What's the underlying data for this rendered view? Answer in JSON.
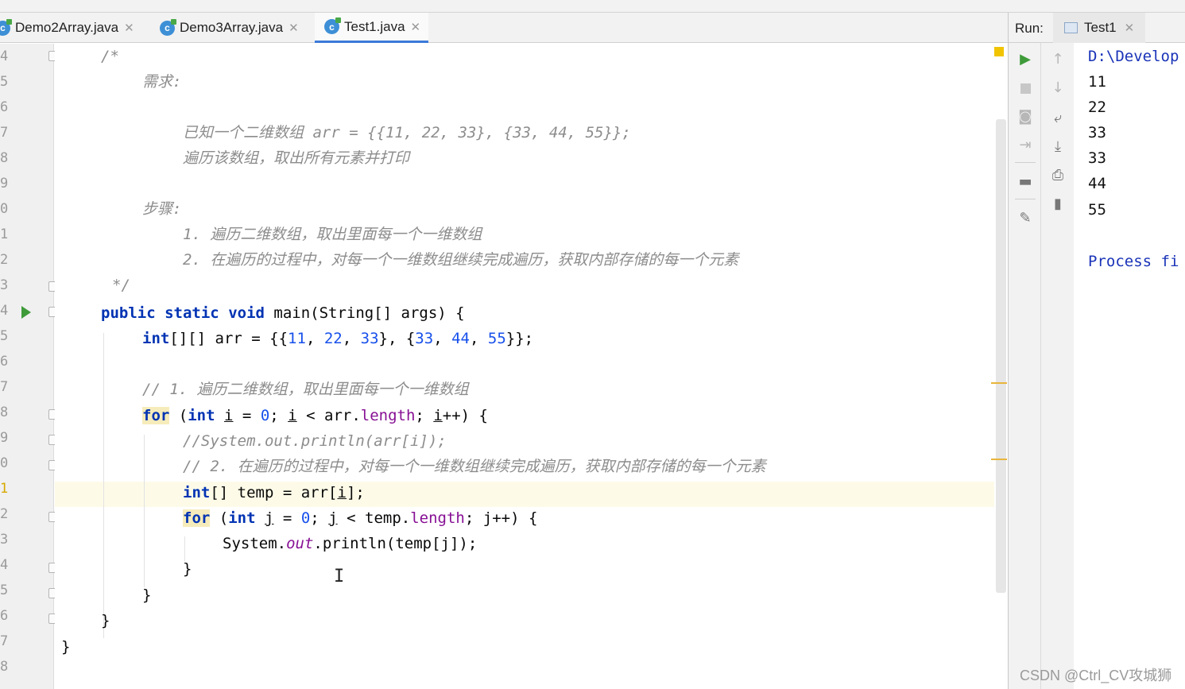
{
  "editor_tabs": [
    {
      "label": "Demo2Array.java"
    },
    {
      "label": "Demo3Array.java"
    },
    {
      "label": "Test1.java",
      "active": true
    }
  ],
  "gutter": {
    "line_numbers": [
      "4",
      "5",
      "6",
      "7",
      "8",
      "9",
      "0",
      "1",
      "2",
      "3",
      "4",
      "5",
      "6",
      "7",
      "8",
      "9",
      "0",
      "1",
      "2",
      "3",
      "4",
      "5",
      "6",
      "7",
      "8"
    ]
  },
  "code": {
    "c1": "/*",
    "c2": "需求:",
    "c4": "已知一个二维数组 arr = {{11, 22, 33}, {33, 44, 55}};",
    "c5": "遍历该数组，取出所有元素并打印",
    "c7": "步骤:",
    "c8": "1. 遍历二维数组，取出里面每一个一维数组",
    "c9": "2. 在遍历的过程中，对每一个一维数组继续完成遍历，获取内部存储的每一个元素",
    "c10": "*/",
    "main_kw1": "public",
    "main_kw2": "static",
    "main_kw3": "void",
    "main_rest": " main(String[] args) {",
    "arr_kw": "int",
    "arr_mid": "[][] arr = {{",
    "n11": "11",
    "n22": "22",
    "n33a": "33",
    "n33b": "33",
    "n44": "44",
    "n55": "55",
    "arr_close": "}};",
    "comment1": "// 1. 遍历二维数组，取出里面每一个一维数组",
    "for_kw": "for",
    "int_kw": "int",
    "var_i": "i",
    "zero": "0",
    "arr_ref": "arr.",
    "length": "length",
    "comment_print": "//System.out.println(arr[i]);",
    "comment2": "// 2. 在遍历的过程中，对每一个一维数组继续完成遍历，获取内部存储的每一个元素",
    "temp_decl": "[] temp = arr[",
    "temp_end": "];",
    "var_j": "j",
    "temp_ref": "temp.",
    "sys": "System.",
    "out": "out",
    "println": ".println(temp[j]);",
    "brace_close": "}",
    "brace_open": ") {",
    "semi": ";",
    "lt": "<",
    "inc": "++",
    "eq": "=",
    "lparen": "(",
    "comma": ",",
    "inner_sep": "}, {"
  },
  "run_panel": {
    "label": "Run:",
    "tab": "Test1",
    "output": {
      "path": "D:\\Develop",
      "lines": [
        "11",
        "22",
        "33",
        "33",
        "44",
        "55"
      ],
      "process": "Process fi"
    }
  },
  "watermark": "CSDN @Ctrl_CV攻城狮",
  "colors": {
    "keyword": "#0033b3",
    "number": "#1750eb",
    "comment": "#8c8c8c",
    "field": "#871094",
    "console_blue": "#1a33b8"
  }
}
